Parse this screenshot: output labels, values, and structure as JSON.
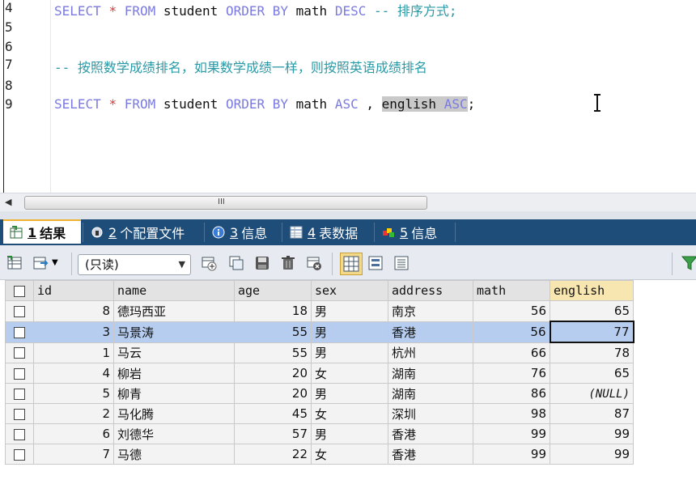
{
  "editor": {
    "lines": [
      {
        "num": "4",
        "tokens": [
          {
            "t": "SELECT",
            "c": "kw"
          },
          {
            "t": " ",
            "c": "id"
          },
          {
            "t": "*",
            "c": "op"
          },
          {
            "t": " ",
            "c": "id"
          },
          {
            "t": "FROM",
            "c": "kw"
          },
          {
            "t": " student ",
            "c": "id"
          },
          {
            "t": "ORDER BY",
            "c": "kw"
          },
          {
            "t": " math ",
            "c": "id"
          },
          {
            "t": "DESC",
            "c": "kw"
          },
          {
            "t": " -- 排序方式;",
            "c": "cm"
          }
        ]
      },
      {
        "num": "5",
        "tokens": []
      },
      {
        "num": "6",
        "tokens": []
      },
      {
        "num": "7",
        "tokens": [
          {
            "t": "-- 按照数学成绩排名，如果数学成绩一样，则按照英语成绩排名",
            "c": "cm"
          }
        ]
      },
      {
        "num": "8",
        "tokens": []
      },
      {
        "num": "9",
        "tokens": [
          {
            "t": "SELECT",
            "c": "kw"
          },
          {
            "t": " ",
            "c": "id"
          },
          {
            "t": "*",
            "c": "op"
          },
          {
            "t": " ",
            "c": "id"
          },
          {
            "t": "FROM",
            "c": "kw"
          },
          {
            "t": " student ",
            "c": "id"
          },
          {
            "t": "ORDER BY",
            "c": "kw"
          },
          {
            "t": " math ",
            "c": "id"
          },
          {
            "t": "ASC",
            "c": "kw"
          },
          {
            "t": " , ",
            "c": "id"
          },
          {
            "t": "english ",
            "c": "id sel"
          },
          {
            "t": "ASC",
            "c": "kw sel"
          },
          {
            "t": ";",
            "c": "id"
          }
        ]
      }
    ]
  },
  "scrollbar": {
    "grip": "III",
    "left_arrow": "◀"
  },
  "tabs": [
    {
      "num": "1",
      "label": "结果",
      "icon": "result-icon",
      "active": true
    },
    {
      "num": "2",
      "label": "个配置文件",
      "icon": "profile-icon",
      "active": false
    },
    {
      "num": "3",
      "label": "信息",
      "icon": "info-icon",
      "active": false
    },
    {
      "num": "4",
      "label": "表数据",
      "icon": "table-data-icon",
      "active": false
    },
    {
      "num": "5",
      "label": "信息",
      "icon": "info-color-icon",
      "active": false
    }
  ],
  "toolbar": {
    "mode": "(只读)"
  },
  "grid": {
    "columns": [
      "id",
      "name",
      "age",
      "sex",
      "address",
      "math",
      "english"
    ],
    "highlight_column": "english",
    "rows": [
      {
        "id": "8",
        "name": "德玛西亚",
        "age": "18",
        "sex": "男",
        "address": "南京",
        "math": "56",
        "english": "65"
      },
      {
        "id": "3",
        "name": "马景涛",
        "age": "55",
        "sex": "男",
        "address": "香港",
        "math": "56",
        "english": "77"
      },
      {
        "id": "1",
        "name": "马云",
        "age": "55",
        "sex": "男",
        "address": "杭州",
        "math": "66",
        "english": "78"
      },
      {
        "id": "4",
        "name": "柳岩",
        "age": "20",
        "sex": "女",
        "address": "湖南",
        "math": "76",
        "english": "65"
      },
      {
        "id": "5",
        "name": "柳青",
        "age": "20",
        "sex": "男",
        "address": "湖南",
        "math": "86",
        "english": "(NULL)"
      },
      {
        "id": "2",
        "name": "马化腾",
        "age": "45",
        "sex": "女",
        "address": "深圳",
        "math": "98",
        "english": "87"
      },
      {
        "id": "6",
        "name": "刘德华",
        "age": "57",
        "sex": "男",
        "address": "香港",
        "math": "99",
        "english": "99"
      },
      {
        "id": "7",
        "name": "马德",
        "age": "22",
        "sex": "女",
        "address": "香港",
        "math": "99",
        "english": "99"
      }
    ],
    "selected_row": 1
  }
}
